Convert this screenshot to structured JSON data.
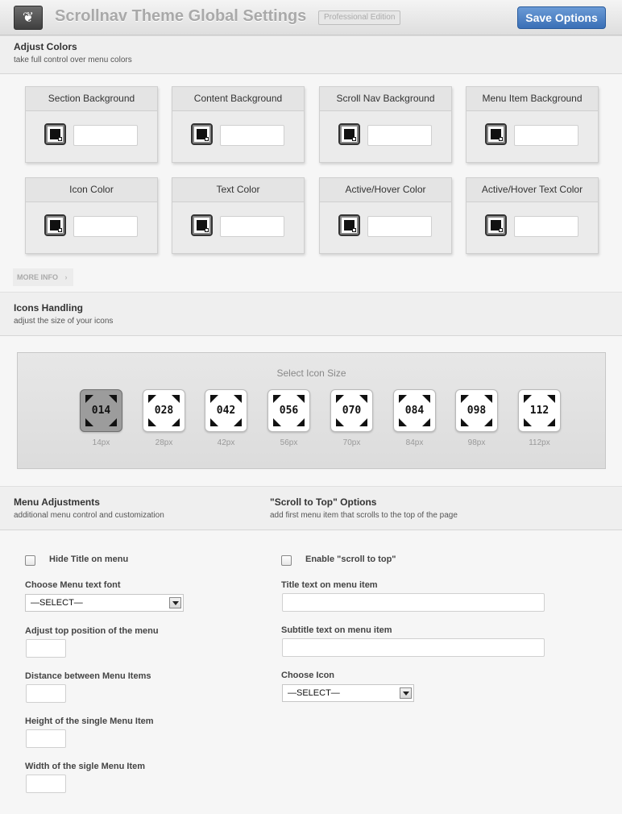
{
  "header": {
    "logo_icon": "leaf-icon",
    "title": "Scrollnav Theme Global Settings",
    "edition": "Professional Edition",
    "save_label": "Save Options"
  },
  "colors_section": {
    "title": "Adjust Colors",
    "subtitle": "take full control over menu colors",
    "boxes": [
      {
        "label": "Section Background"
      },
      {
        "label": "Content Background"
      },
      {
        "label": "Scroll Nav Background"
      },
      {
        "label": "Menu Item Background"
      },
      {
        "label": "Icon Color"
      },
      {
        "label": "Text Color"
      },
      {
        "label": "Active/Hover Color"
      },
      {
        "label": "Active/Hover Text Color"
      }
    ],
    "more_info": "MORE INFO",
    "more_info_arrow": "›"
  },
  "icons_section": {
    "title": "Icons Handling",
    "subtitle": "adjust the size of your icons",
    "panel_title": "Select Icon Size",
    "sizes": [
      {
        "num": "014",
        "label": "14px",
        "selected": true
      },
      {
        "num": "028",
        "label": "28px",
        "selected": false
      },
      {
        "num": "042",
        "label": "42px",
        "selected": false
      },
      {
        "num": "056",
        "label": "56px",
        "selected": false
      },
      {
        "num": "070",
        "label": "70px",
        "selected": false
      },
      {
        "num": "084",
        "label": "84px",
        "selected": false
      },
      {
        "num": "098",
        "label": "98px",
        "selected": false
      },
      {
        "num": "112",
        "label": "112px",
        "selected": false
      }
    ]
  },
  "menu_section": {
    "title": "Menu Adjustments",
    "subtitle": "additional menu control and customization",
    "hide_title_label": "Hide Title on menu",
    "font_label": "Choose Menu text font",
    "font_value": "—SELECT—",
    "top_position_label": "Adjust top position of the menu",
    "distance_label": "Distance between Menu Items",
    "height_label": "Height of the single Menu Item",
    "width_label": "Width of the sigle Menu Item"
  },
  "scroll_section": {
    "title": "\"Scroll to Top\" Options",
    "subtitle": "add first menu item that scrolls to the top of the page",
    "enable_label": "Enable \"scroll to top\"",
    "title_text_label": "Title text on menu item",
    "subtitle_text_label": "Subtitle text on menu item",
    "icon_label": "Choose Icon",
    "icon_value": "—SELECT—"
  },
  "colors": {
    "accent": "#3a6fb6",
    "selected_icon": "#9c9c9c"
  }
}
